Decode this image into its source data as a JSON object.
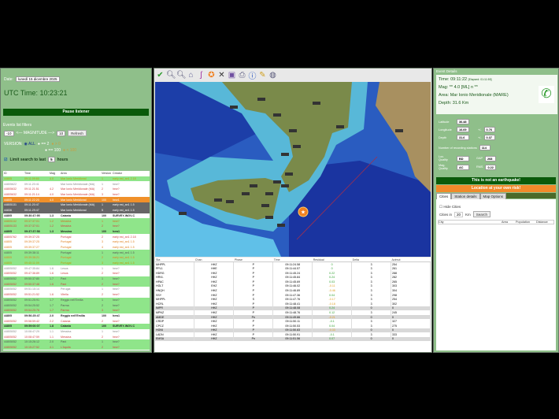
{
  "left": {
    "date_label": "Date:",
    "date_value": "lunedì 15 dicembre 2025",
    "utc_time": "UTC Time: 10:23:21",
    "pause_button": "Pause listener",
    "filters_title": "Events list filters",
    "mag_min": "-10",
    "mag_label": "<— MAGNITUDE —>",
    "mag_max": "10",
    "refresh_button": "Refresh",
    "version_label": "VERSION",
    "version_options": [
      "ALL",
      "== 2",
      "== 100",
      "> 0",
      "< 100"
    ],
    "limit_label": "Limit search to last",
    "limit_value": "5",
    "limit_unit": "hours",
    "columns": [
      "ID",
      "Time",
      "Mag",
      "Area",
      "Version",
      "Creator"
    ],
    "events": [
      {
        "s": "g",
        "c": "#b8a000",
        "id": "44805",
        "t": "09:11:09:60",
        "m": "4.0",
        "a": "Mar Ionio Meridional",
        "v": "1",
        "cr": "early est_an1 2.18"
      },
      {
        "s": "w",
        "c": "#888",
        "id": "44805622",
        "t": "09:11:20:41",
        "m": "",
        "a": "Mar Ionio Meridionale (MA)",
        "v": "1",
        "cr": "hew?"
      },
      {
        "s": "w",
        "c": "#d04040",
        "id": "44805632",
        "t": "09:11:21:51",
        "m": "4.2",
        "a": "Mar Ionio Meridionale (MA)",
        "v": "2",
        "cr": "hew?"
      },
      {
        "s": "w",
        "c": "#d04040",
        "id": "44805632",
        "t": "09:11:21:14",
        "m": "4.0",
        "a": "Mar Ionio Meridionale (MA)",
        "v": "3",
        "cr": "hew?"
      },
      {
        "s": "o",
        "c": "#fff",
        "id": "44805",
        "t": "09:11:22:20",
        "m": "4.0",
        "a": "Mar Ionio Meridional",
        "v": "100",
        "cr": "hew1"
      },
      {
        "s": "d",
        "c": "#fff",
        "id": "44805131",
        "t": "09:11:20:47",
        "m": "",
        "a": "Mar Ionio Meridionale (MA)",
        "v": "1",
        "cr": "early est_an1 1.5"
      },
      {
        "s": "d",
        "c": "#fff",
        "id": "44836",
        "t": "09:11:29:47",
        "m": "",
        "a": "Mar Ionio Meridional",
        "v": "5",
        "cr": "early est_an1 1.5"
      },
      {
        "s": "w b",
        "c": "#222",
        "id": "44805",
        "t": "09:30:47:95",
        "m": "1.3",
        "a": "Catania",
        "v": "100",
        "cr": "SURVEY-INGV-C"
      },
      {
        "s": "g",
        "c": "#d07020",
        "id": "44805132",
        "t": "09:37:37:01",
        "m": "1.2",
        "a": "Messina",
        "v": "1",
        "cr": "hew?"
      },
      {
        "s": "g",
        "c": "#d04040",
        "id": "44805133",
        "t": "09:37:37:01",
        "m": "1.2",
        "a": "Messina",
        "v": "2",
        "cr": "hew?"
      },
      {
        "s": "g b",
        "c": "#222",
        "id": "44805",
        "t": "09:37:37:58",
        "m": "1.3",
        "a": "Messina",
        "v": "100",
        "cr": "hew1"
      },
      {
        "s": "w",
        "c": "#d04040",
        "id": "44805762",
        "t": "09:39:37:25",
        "m": "",
        "a": "Portugal",
        "v": "2",
        "cr": "early est_an1 2.18"
      },
      {
        "s": "w",
        "c": "#e08020",
        "id": "44805",
        "t": "09:39:37:25",
        "m": "",
        "a": "Portugal",
        "v": "3",
        "cr": "early est_an1 1.5"
      },
      {
        "s": "w",
        "c": "#e08020",
        "id": "44805",
        "t": "09:39:37:27",
        "m": "",
        "a": "Portugal",
        "v": "4",
        "cr": "early est_an1 1.5"
      },
      {
        "s": "g",
        "c": "#555",
        "id": "44805",
        "t": "09:39:38:11",
        "m": "",
        "a": "Portugal",
        "v": "1",
        "cr": "early est_an1 1.5"
      },
      {
        "s": "g",
        "c": "#e08020",
        "id": "44805",
        "t": "09:39:38:21",
        "m": "",
        "a": "Portugal",
        "v": "2",
        "cr": "early est_an1 1.5"
      },
      {
        "s": "g",
        "c": "#b8a000",
        "id": "44805",
        "t": "09:40:11:09",
        "m": "",
        "a": "Portugal",
        "v": "3",
        "cr": "early est_an1 1.5"
      },
      {
        "s": "w",
        "c": "#888",
        "id": "44805052",
        "t": "09:47:35:84",
        "m": "1.6",
        "a": "Lesos",
        "v": "1",
        "cr": "hew?"
      },
      {
        "s": "w",
        "c": "#d04040",
        "id": "44805052",
        "t": "09:47:36:89",
        "m": "1.6",
        "a": "Lesos",
        "v": "2",
        "cr": "hew?"
      },
      {
        "s": "g",
        "c": "#555",
        "id": "44805052",
        "t": "09:50:37:80",
        "m": "1.7",
        "a": "Pani",
        "v": "1",
        "cr": "hew?"
      },
      {
        "s": "g",
        "c": "#d04040",
        "id": "44805052",
        "t": "09:50:37:48",
        "m": "1.6",
        "a": "Pani",
        "v": "2",
        "cr": "hew?"
      },
      {
        "s": "w",
        "c": "#888",
        "id": "44805052",
        "t": "09:51:15:14",
        "m": "",
        "a": "Perugia",
        "v": "1",
        "cr": "hew?"
      },
      {
        "s": "w",
        "c": "#d04040",
        "id": "44805052",
        "t": "09:51:21:52",
        "m": "1.6",
        "a": "Vitella",
        "v": "2",
        "cr": "hew?"
      },
      {
        "s": "g",
        "c": "#555",
        "id": "44805052",
        "t": "09:51:25:91",
        "m": "1.7",
        "a": "Reggio nell'Emilia",
        "v": "1",
        "cr": "hew?"
      },
      {
        "s": "g",
        "c": "#555",
        "id": "44805052",
        "t": "09:54:25:52",
        "m": "1.7",
        "a": "Parma",
        "v": "2",
        "cr": "hew?"
      },
      {
        "s": "g",
        "c": "#d04040",
        "id": "44805052",
        "t": "09:54:25:76",
        "m": "1.7",
        "a": "Parma",
        "v": "3",
        "cr": "hew?"
      },
      {
        "s": "w b",
        "c": "#222",
        "id": "44805",
        "t": "09:56:25:47",
        "m": "2.0",
        "a": "Reggio nell'Emilia",
        "v": "100",
        "cr": "hew1"
      },
      {
        "s": "w",
        "c": "#d04040",
        "id": "44805052",
        "t": "09:58:59:42",
        "m": "2.2",
        "a": "Catania",
        "v": "2",
        "cr": "hew?"
      },
      {
        "s": "g b",
        "c": "#222",
        "id": "44805",
        "t": "09:59:00:07",
        "m": "1.8",
        "a": "Catania",
        "v": "100",
        "cr": "SURVEY-INGV-C"
      },
      {
        "s": "w",
        "c": "#888",
        "id": "44805052",
        "t": "10:08:47:29",
        "m": "1.1",
        "a": "Messina",
        "v": "1",
        "cr": "hew?"
      },
      {
        "s": "w",
        "c": "#d04040",
        "id": "44805052",
        "t": "10:08:47:59",
        "m": "1.1",
        "a": "Messina",
        "v": "2",
        "cr": "hew?"
      },
      {
        "s": "g",
        "c": "#555",
        "id": "44805052",
        "t": "10:15:26:12",
        "m": "2.0",
        "a": "Pani",
        "v": "1",
        "cr": "hew?"
      },
      {
        "s": "g",
        "c": "#d04040",
        "id": "44805052",
        "t": "10:15:27:52",
        "m": "4.1",
        "a": "L'Aquila",
        "v": "2",
        "cr": "hew?"
      }
    ]
  },
  "map": {
    "toolbar_icons": [
      "check-icon",
      "zoom-in-icon",
      "zoom-out-icon",
      "home-icon",
      "italy-icon",
      "star-icon",
      "close-icon",
      "select-box-icon",
      "print-icon",
      "info-icon",
      "pencil-icon",
      "globe-icon"
    ],
    "colors": {
      "deep": "#1a3fa8",
      "mid": "#2f6fd0",
      "shelf": "#5fc8e0",
      "land": "#7a8a4a",
      "epicenter": "#f08020"
    }
  },
  "stations": {
    "columns": [
      "Sta",
      "Chan",
      "Phase",
      "Time",
      "Residual",
      "Delta",
      "Azimut"
    ],
    "rows": [
      [
        "MHPPL",
        "HHZ",
        "P",
        "09:11:24.58",
        "0",
        "3",
        "254",
        ""
      ],
      [
        "PPL1",
        "HHE",
        "P",
        "09:11:44.57",
        "0",
        "3",
        "261",
        ""
      ],
      [
        "HDRG",
        "HHZ",
        "P",
        "09:11:45.24",
        "0.22",
        "3",
        "288",
        ""
      ],
      [
        "HRVL",
        "HHZ",
        "P",
        "09:11:45.84",
        "0.24",
        "3",
        "282",
        ""
      ],
      [
        "HPAC",
        "HHZ",
        "P",
        "09:11:45.69",
        "0.03",
        "3",
        "265",
        ""
      ],
      [
        "HGLT",
        "EHZ",
        "P",
        "09:11:46.02",
        "-0.11",
        "3",
        "303",
        ""
      ],
      [
        "HNQH",
        "HHZ",
        "P",
        "09:11:46.89",
        "-0.46",
        "3",
        "304",
        ""
      ],
      [
        "SSY",
        "HHZ",
        "P",
        "09:11:47.36",
        "0.04",
        "3",
        "298",
        ""
      ],
      [
        "MHPPL",
        "HHZ",
        "S",
        "09:11:47.76",
        "-0.17",
        "3",
        "254",
        ""
      ],
      [
        "HCRL",
        "HHZ",
        "P",
        "09:11:48.41",
        "-0.18",
        "3",
        "302",
        ""
      ],
      [
        "IMPR",
        "HHZ",
        "P",
        "09:11:48.08",
        "0.24",
        "0",
        "0",
        "gr"
      ],
      [
        "MPNZ",
        "HHZ",
        "P",
        "09:11:48.76",
        "0.12",
        "3",
        "245",
        ""
      ],
      [
        "AMDE",
        "HHZ",
        "Pn",
        "09:11:49.66",
        "-0.21",
        "0",
        "0",
        "gr"
      ],
      [
        "CRDP",
        "HHZ",
        "P",
        "09:11:50.11",
        "-0.1",
        "3",
        "327",
        ""
      ],
      [
        "CPCZ",
        "HHZ",
        "P",
        "09:11:50.53",
        "0.04",
        "3",
        "275",
        ""
      ],
      [
        "HGNI",
        "HHZ",
        "P",
        "09:11:50.83",
        "-0.33",
        "0",
        "0",
        "gr"
      ],
      [
        "LADN",
        "HHZ",
        "P",
        "09:11:50.91",
        "-0.1",
        "3",
        "333",
        ""
      ],
      [
        "EMSA",
        "HHZ",
        "Pn",
        "09:11:51.56",
        "0.07",
        "0",
        "0",
        "gr"
      ]
    ]
  },
  "right": {
    "title": "Event Details",
    "time_label": "Time:",
    "time_value": "09:11:22",
    "elapsed": "[Elapsed: 01:11:59]",
    "mag": "Mag: ** 4.0 [ML] n **",
    "area_label": "Area:",
    "area_value": "Mar Ionio Meridionale (MARE)",
    "depth": "Depth: 31.6 Km",
    "lat_label": "Latitude",
    "lat": "36.48",
    "lon_label": "Longitude",
    "lon": "16.69",
    "pm": "+/-",
    "lon_err": "0.76",
    "dep_label": "Depth",
    "dep": "31.6",
    "dep_err": "0.37",
    "nsta_label": "Number of recording stations",
    "nsta": "114",
    "locq_label": "Loc. Quality",
    "locq": "BD",
    "gap_label": "GAP",
    "gap": "268",
    "magq_label": "Mag. Quality",
    "magq": "AC",
    "rms_label": "RMS",
    "rms": "0.22",
    "not_eq_button": "This is not an earthquake!",
    "risk_button": "Location at your own risk!",
    "tabs": [
      "Cities",
      "Station details",
      "Map Options"
    ],
    "hide_cities": "Hide Cities",
    "cities_in": "Cities in",
    "radius": "20",
    "km": "Km",
    "search_button": "Search",
    "city_columns": [
      "City",
      "Area",
      "Population",
      "Distance"
    ]
  }
}
